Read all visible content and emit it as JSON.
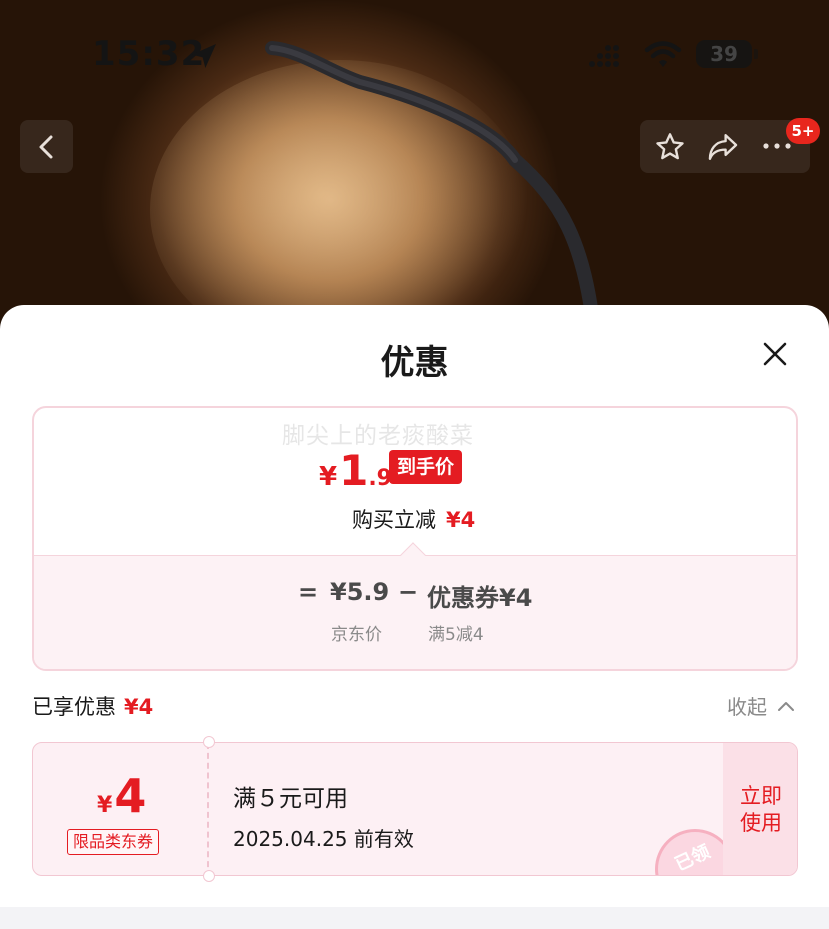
{
  "status_bar": {
    "time": "15:32",
    "battery": "39"
  },
  "nav": {
    "badge": "5+"
  },
  "sheet": {
    "title": "优惠",
    "watermark": "脚尖上的老痰酸菜",
    "final_price": {
      "symbol": "¥",
      "integer": "1",
      "decimal": ".9",
      "tag": "到手价"
    },
    "discount": {
      "label": "购买立减",
      "amount": "¥4"
    },
    "calc": {
      "equals": "=",
      "price": "¥5.9",
      "minus": "−",
      "coupon": "优惠券¥4",
      "price_label": "京东价",
      "coupon_label": "满5减4"
    },
    "applied": {
      "label": "已享优惠",
      "amount": "¥4",
      "collapse_label": "收起"
    },
    "coupon": {
      "symbol": "¥",
      "amount": "4",
      "type": "限品类东券",
      "condition": "满５元可用",
      "valid": "2025.04.25 前有效",
      "use_button": "立即使用",
      "stamp": "已领"
    }
  }
}
